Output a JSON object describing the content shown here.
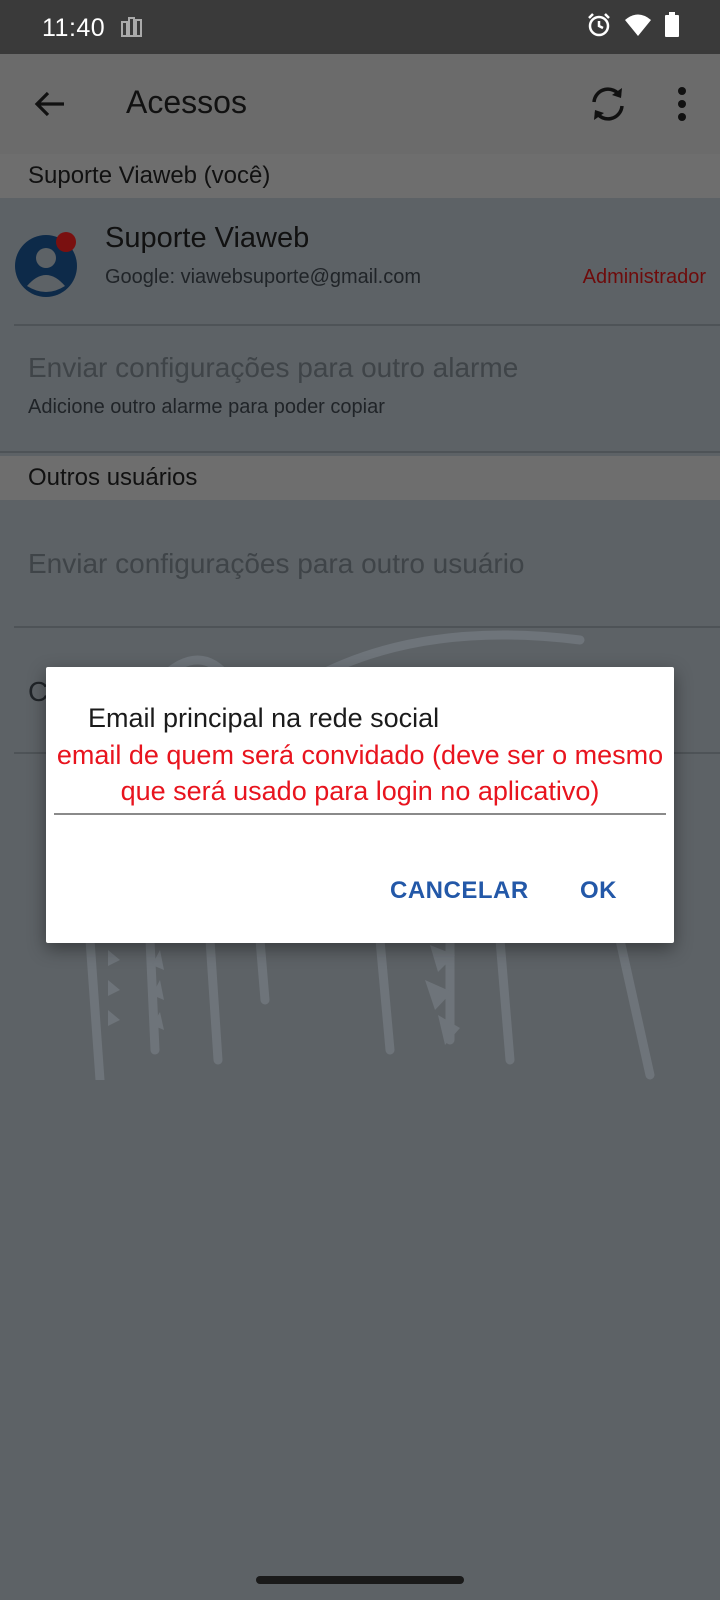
{
  "status_bar": {
    "time": "11:40",
    "icons": [
      "notification-icon",
      "alarm-icon",
      "wifi-icon",
      "battery-icon"
    ]
  },
  "app_bar": {
    "title": "Acessos",
    "icons": [
      "back-arrow-icon",
      "sync-icon",
      "more-vert-icon"
    ]
  },
  "sections": {
    "self_header": "Suporte Viaweb (você)",
    "others_header": "Outros usuários"
  },
  "self_user": {
    "name": "Suporte Viaweb",
    "email": "Google: viawebsuporte@gmail.com",
    "role": "Administrador"
  },
  "items": {
    "send_config_alarm_title": "Enviar configurações para outro alarme",
    "send_config_alarm_sub": "Adicione outro alarme para poder copiar",
    "send_config_user_title": "Enviar configurações para outro usuário",
    "partial_item_letter": "C"
  },
  "dialog": {
    "title": "Email principal na rede social",
    "note": "email de quem será convidado (deve ser o mesmo que será usado para login no aplicativo)",
    "cancel_label": "CANCELAR",
    "ok_label": "OK",
    "input_value": ""
  },
  "colors": {
    "accent": "#2358a8",
    "note_red": "#e8141e",
    "role_red": "#6e0b0b",
    "scrim": "#5d6266"
  }
}
